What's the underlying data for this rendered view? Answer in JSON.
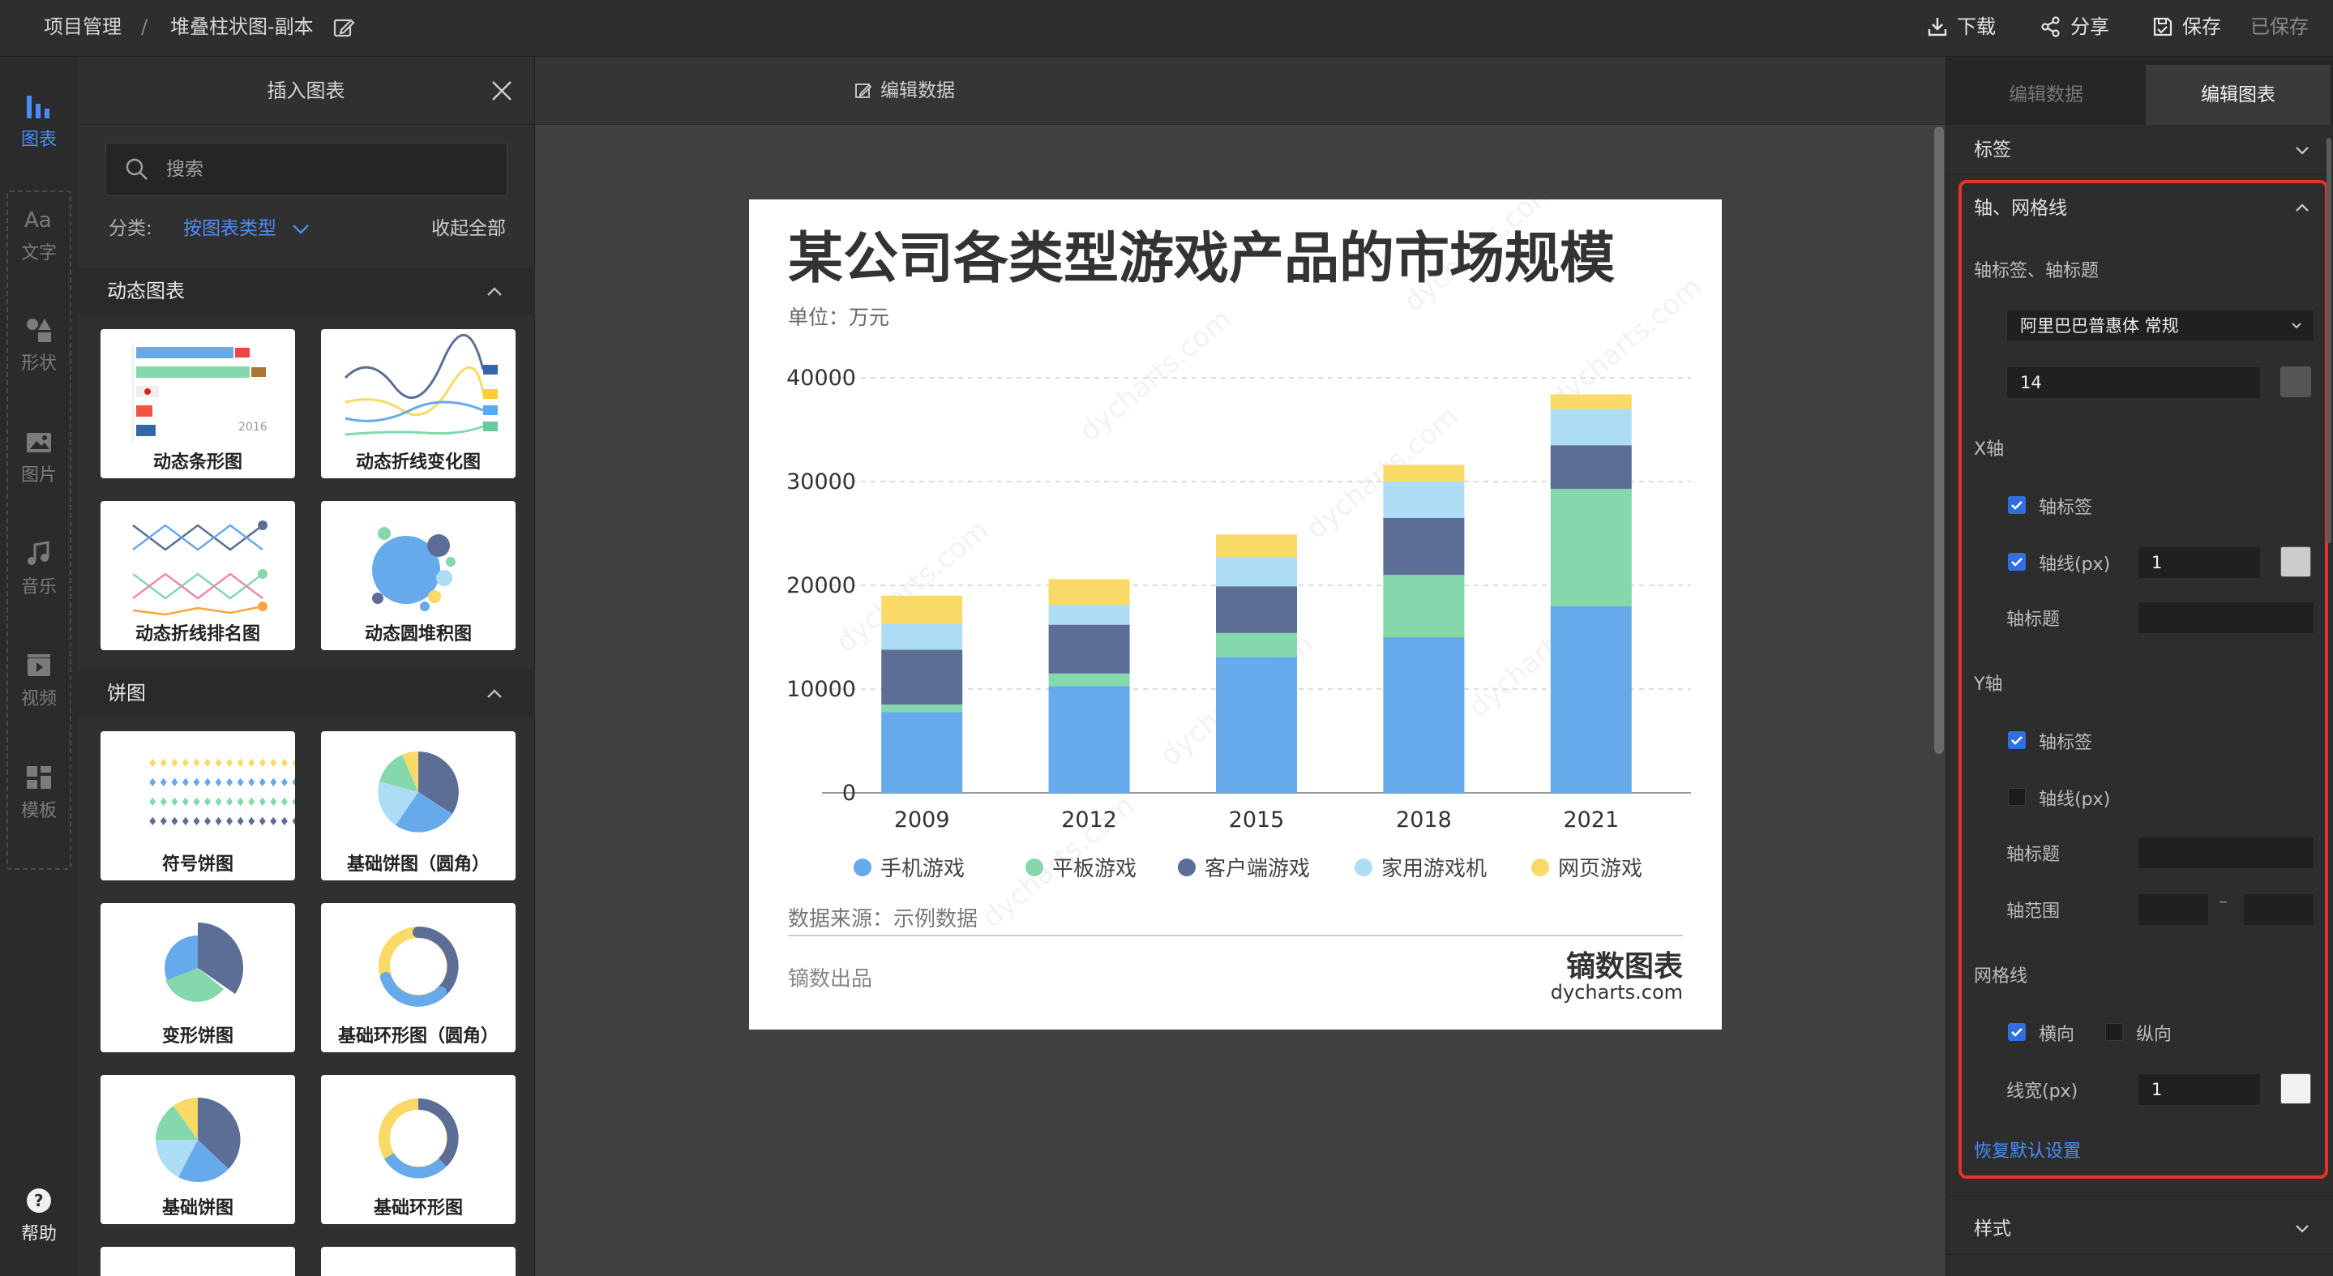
{
  "breadcrumb": {
    "root": "项目管理",
    "sep": "/",
    "current": "堆叠柱状图-副本"
  },
  "topbar": {
    "download": "下载",
    "share": "分享",
    "save": "保存",
    "saved": "已保存"
  },
  "leftbar": {
    "items": [
      {
        "label": "图表",
        "icon": "bar-chart-icon",
        "active": true
      },
      {
        "label": "文字",
        "icon": "text-icon"
      },
      {
        "label": "形状",
        "icon": "shapes-icon"
      },
      {
        "label": "图片",
        "icon": "image-icon"
      },
      {
        "label": "音乐",
        "icon": "music-icon"
      },
      {
        "label": "视频",
        "icon": "video-icon"
      },
      {
        "label": "模板",
        "icon": "template-icon"
      }
    ],
    "help": "帮助"
  },
  "panel": {
    "title": "插入图表",
    "search_placeholder": "搜索",
    "category_label": "分类:",
    "category_value": "按图表类型",
    "collapse_all": "收起全部",
    "sections": [
      {
        "title": "动态图表",
        "cards": [
          "动态条形图",
          "动态折线变化图",
          "动态折线排名图",
          "动态圆堆积图"
        ]
      },
      {
        "title": "饼图",
        "cards": [
          "符号饼图",
          "基础饼图（圆角）",
          "变形饼图",
          "基础环形图（圆角）",
          "基础饼图",
          "基础环形图"
        ]
      }
    ]
  },
  "canvas": {
    "edit_data_label": "编辑数据"
  },
  "chart": {
    "title": "某公司各类型游戏产品的市场规模",
    "unit": "单位：万元",
    "watermark": "dycharts.com",
    "source": "数据来源：示例数据",
    "footer_left": "镝数出品",
    "brand_cn": "镝数图表",
    "brand_en": "dycharts.com"
  },
  "chart_data": {
    "type": "bar",
    "stacked": true,
    "categories": [
      "2009",
      "2012",
      "2015",
      "2018",
      "2021"
    ],
    "series": [
      {
        "name": "手机游戏",
        "color": "#67aaec",
        "values": [
          7800,
          10300,
          13100,
          15000,
          18000
        ]
      },
      {
        "name": "平板游戏",
        "color": "#84d8ac",
        "values": [
          700,
          1200,
          2300,
          6000,
          11300
        ]
      },
      {
        "name": "客户端游戏",
        "color": "#5d6e96",
        "values": [
          5300,
          4700,
          4500,
          5500,
          4200
        ]
      },
      {
        "name": "家用游戏机",
        "color": "#addcf5",
        "values": [
          2500,
          1900,
          2800,
          3500,
          3500
        ]
      },
      {
        "name": "网页游戏",
        "color": "#f9da66",
        "values": [
          2700,
          2500,
          2200,
          1600,
          1400
        ]
      }
    ],
    "yticks": [
      0,
      10000,
      20000,
      30000,
      40000
    ],
    "ylim": [
      0,
      40000
    ],
    "grid": true,
    "legend": "bottom"
  },
  "right_panel": {
    "tabs": [
      {
        "label": "编辑数据",
        "active": false
      },
      {
        "label": "编辑图表",
        "active": true
      }
    ],
    "label_section": "标签",
    "axis_section": "轴、网格线",
    "axis_label_title": "轴标签、轴标题",
    "font_value": "阿里巴巴普惠体 常规",
    "font_size": "14",
    "x_axis": "X轴",
    "x_axis_label": "轴标签",
    "x_axis_line": "轴线(px)",
    "x_axis_line_value": "1",
    "x_axis_title": "轴标题",
    "y_axis": "Y轴",
    "y_axis_label": "轴标签",
    "y_axis_line": "轴线(px)",
    "y_axis_title": "轴标题",
    "y_axis_range": "轴范围",
    "range_sep": "–",
    "grid_section": "网格线",
    "grid_h": "横向",
    "grid_v": "纵向",
    "grid_width": "线宽(px)",
    "grid_width_value": "1",
    "reset": "恢复默认设置",
    "style_section": "样式",
    "colors": {
      "font_swatch": "#555555",
      "xline_swatch": "#cccccc",
      "grid_swatch": "#f2f2f2"
    }
  }
}
